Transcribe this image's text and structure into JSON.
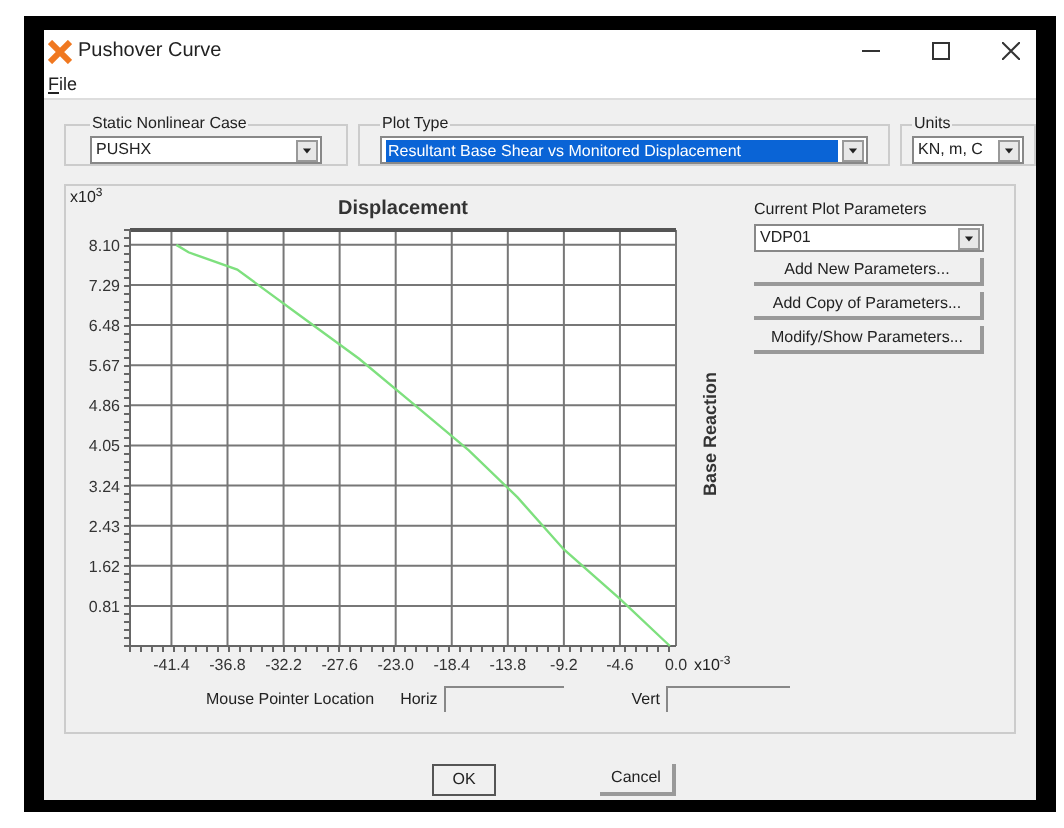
{
  "window": {
    "title": "Pushover Curve"
  },
  "menu": [
    {
      "label": "File"
    }
  ],
  "static_nonlinear_case": {
    "label": "Static Nonlinear Case",
    "value": "PUSHX"
  },
  "plot_type": {
    "label": "Plot Type",
    "value": "Resultant Base Shear vs Monitored Displacement"
  },
  "units": {
    "label": "Units",
    "value": "KN, m, C"
  },
  "chart": {
    "y_scale": "x10$^{3}$",
    "x_scale": "x10$^{-3}$",
    "chart_data": {
      "type": "line",
      "grid": true,
      "title": "Displacement",
      "ylabel": "Base Reaction",
      "x": [
        -41.0,
        -40.0,
        -36.0,
        -31.0,
        -26.0,
        -21.6,
        -17.0,
        -13.0,
        -9.2,
        -4.6,
        -0.5
      ],
      "values": [
        8.1,
        7.95,
        7.6,
        6.7,
        5.8,
        4.9,
        3.95,
        3.0,
        1.95,
        0.95,
        0.0
      ],
      "xlim": [
        -44.8,
        0
      ],
      "ylim": [
        0,
        8.4
      ],
      "xticks": [
        {
          "value": -41.4,
          "label": "-41.4"
        },
        {
          "value": -36.8,
          "label": "-36.8"
        },
        {
          "value": -32.2,
          "label": "-32.2"
        },
        {
          "value": -27.6,
          "label": "-27.6"
        },
        {
          "value": -23.0,
          "label": "-23.0"
        },
        {
          "value": -18.4,
          "label": "-18.4"
        },
        {
          "value": -13.8,
          "label": "-13.8"
        },
        {
          "value": -9.2,
          "label": "-9.2"
        },
        {
          "value": -4.6,
          "label": "-4.6"
        },
        {
          "value": 0,
          "label": "0.0"
        }
      ],
      "yticks": [
        {
          "value": 0.81,
          "label": "0.81"
        },
        {
          "value": 1.62,
          "label": "1.62"
        },
        {
          "value": 2.43,
          "label": "2.43"
        },
        {
          "value": 3.24,
          "label": "3.24"
        },
        {
          "value": 4.05,
          "label": "4.05"
        },
        {
          "value": 4.86,
          "label": "4.86"
        },
        {
          "value": 5.67,
          "label": "5.67"
        },
        {
          "value": 6.48,
          "label": "6.48"
        },
        {
          "value": 7.29,
          "label": "7.29"
        },
        {
          "value": 8.1,
          "label": "8.10"
        }
      ]
    }
  },
  "plot_parameters": {
    "label": "Current Plot Parameters",
    "value": "VDP01",
    "buttons": [
      "Add New Parameters...",
      "Add Copy of Parameters...",
      "Modify/Show Parameters..."
    ]
  },
  "mouse_pointer": {
    "label": "Mouse Pointer Location",
    "horiz_label": "Horiz",
    "vert_label": "Vert"
  },
  "buttons": [
    "OK",
    "Cancel"
  ]
}
